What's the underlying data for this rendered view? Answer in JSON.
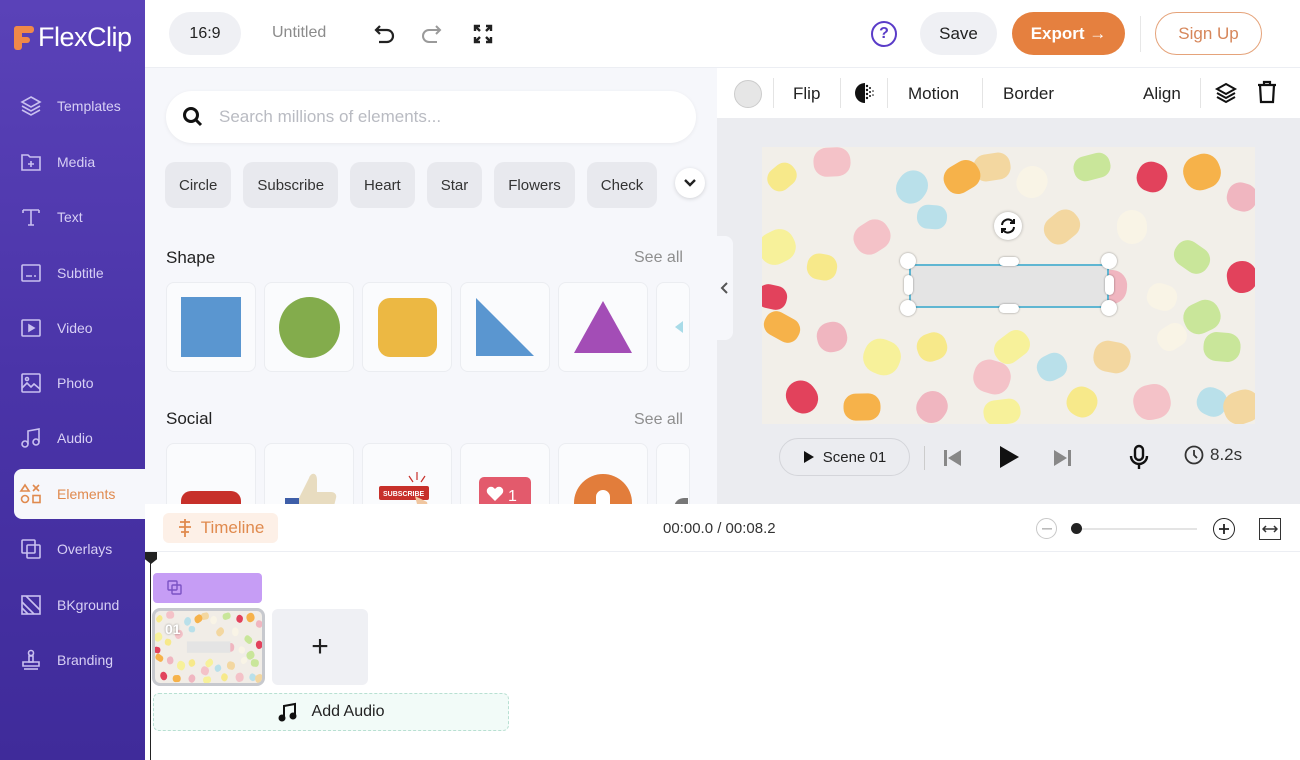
{
  "app": {
    "name": "FlexClip"
  },
  "sidebar": {
    "items": [
      {
        "label": "Templates",
        "icon": "layers-icon"
      },
      {
        "label": "Media",
        "icon": "folder-plus-icon"
      },
      {
        "label": "Text",
        "icon": "text-t-icon"
      },
      {
        "label": "Subtitle",
        "icon": "subtitle-icon"
      },
      {
        "label": "Video",
        "icon": "video-icon"
      },
      {
        "label": "Photo",
        "icon": "photo-icon"
      },
      {
        "label": "Audio",
        "icon": "music-icon"
      },
      {
        "label": "Elements",
        "icon": "elements-icon",
        "active": true
      },
      {
        "label": "Overlays",
        "icon": "overlays-icon"
      },
      {
        "label": "BKground",
        "icon": "background-icon"
      },
      {
        "label": "Branding",
        "icon": "stamp-icon"
      }
    ]
  },
  "topbar": {
    "ratio": "16:9",
    "title": "Untitled",
    "save_label": "Save",
    "export_label": "Export →",
    "signup_label": "Sign Up",
    "help_label": "?"
  },
  "panel": {
    "search_placeholder": "Search millions of elements...",
    "chips": [
      "Circle",
      "Subscribe",
      "Heart",
      "Star",
      "Flowers",
      "Check"
    ],
    "sections": [
      {
        "title": "Shape",
        "see_all": "See all",
        "items": [
          "square",
          "circle",
          "rounded-square",
          "right-triangle",
          "triangle"
        ]
      },
      {
        "title": "Social",
        "see_all": "See all",
        "items": [
          "youtube-play",
          "thumbs-up",
          "subscribe-button",
          "like-notification",
          "bell"
        ]
      }
    ]
  },
  "properties": {
    "flip": "Flip",
    "motion": "Motion",
    "border": "Border",
    "align": "Align"
  },
  "player": {
    "scene_label": "Scene 01",
    "duration": "8.2s"
  },
  "timeline": {
    "tab_label": "Timeline",
    "time_readout": "00:00.0 / 00:08.2",
    "scenes": [
      {
        "number": "01"
      }
    ],
    "add_audio_label": "Add Audio",
    "add_scene_label": "+",
    "zoom_level": 0
  },
  "colors": {
    "sidebar": "#4a34a8",
    "accent": "#e5803f",
    "shape_blue": "#5a96d0",
    "shape_green": "#83ac4c",
    "shape_yellow": "#ecb843",
    "shape_purple": "#a34db6",
    "overlay_track": "#c69df5"
  }
}
